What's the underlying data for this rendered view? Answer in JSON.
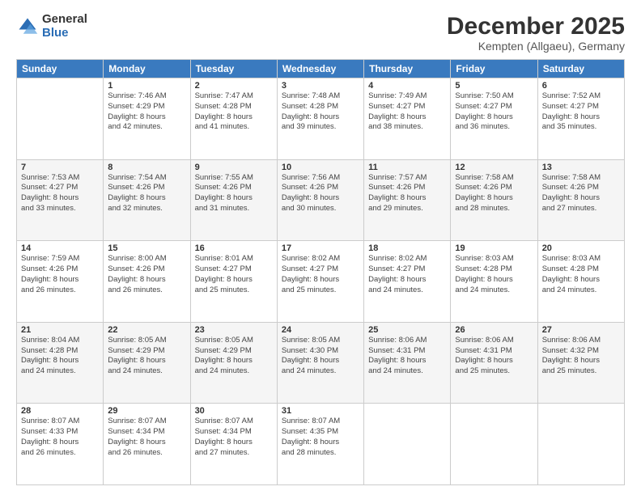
{
  "logo": {
    "general": "General",
    "blue": "Blue"
  },
  "header": {
    "month": "December 2025",
    "location": "Kempten (Allgaeu), Germany"
  },
  "weekdays": [
    "Sunday",
    "Monday",
    "Tuesday",
    "Wednesday",
    "Thursday",
    "Friday",
    "Saturday"
  ],
  "weeks": [
    [
      {
        "day": "",
        "info": ""
      },
      {
        "day": "1",
        "info": "Sunrise: 7:46 AM\nSunset: 4:29 PM\nDaylight: 8 hours\nand 42 minutes."
      },
      {
        "day": "2",
        "info": "Sunrise: 7:47 AM\nSunset: 4:28 PM\nDaylight: 8 hours\nand 41 minutes."
      },
      {
        "day": "3",
        "info": "Sunrise: 7:48 AM\nSunset: 4:28 PM\nDaylight: 8 hours\nand 39 minutes."
      },
      {
        "day": "4",
        "info": "Sunrise: 7:49 AM\nSunset: 4:27 PM\nDaylight: 8 hours\nand 38 minutes."
      },
      {
        "day": "5",
        "info": "Sunrise: 7:50 AM\nSunset: 4:27 PM\nDaylight: 8 hours\nand 36 minutes."
      },
      {
        "day": "6",
        "info": "Sunrise: 7:52 AM\nSunset: 4:27 PM\nDaylight: 8 hours\nand 35 minutes."
      }
    ],
    [
      {
        "day": "7",
        "info": "Sunrise: 7:53 AM\nSunset: 4:27 PM\nDaylight: 8 hours\nand 33 minutes."
      },
      {
        "day": "8",
        "info": "Sunrise: 7:54 AM\nSunset: 4:26 PM\nDaylight: 8 hours\nand 32 minutes."
      },
      {
        "day": "9",
        "info": "Sunrise: 7:55 AM\nSunset: 4:26 PM\nDaylight: 8 hours\nand 31 minutes."
      },
      {
        "day": "10",
        "info": "Sunrise: 7:56 AM\nSunset: 4:26 PM\nDaylight: 8 hours\nand 30 minutes."
      },
      {
        "day": "11",
        "info": "Sunrise: 7:57 AM\nSunset: 4:26 PM\nDaylight: 8 hours\nand 29 minutes."
      },
      {
        "day": "12",
        "info": "Sunrise: 7:58 AM\nSunset: 4:26 PM\nDaylight: 8 hours\nand 28 minutes."
      },
      {
        "day": "13",
        "info": "Sunrise: 7:58 AM\nSunset: 4:26 PM\nDaylight: 8 hours\nand 27 minutes."
      }
    ],
    [
      {
        "day": "14",
        "info": "Sunrise: 7:59 AM\nSunset: 4:26 PM\nDaylight: 8 hours\nand 26 minutes."
      },
      {
        "day": "15",
        "info": "Sunrise: 8:00 AM\nSunset: 4:26 PM\nDaylight: 8 hours\nand 26 minutes."
      },
      {
        "day": "16",
        "info": "Sunrise: 8:01 AM\nSunset: 4:27 PM\nDaylight: 8 hours\nand 25 minutes."
      },
      {
        "day": "17",
        "info": "Sunrise: 8:02 AM\nSunset: 4:27 PM\nDaylight: 8 hours\nand 25 minutes."
      },
      {
        "day": "18",
        "info": "Sunrise: 8:02 AM\nSunset: 4:27 PM\nDaylight: 8 hours\nand 24 minutes."
      },
      {
        "day": "19",
        "info": "Sunrise: 8:03 AM\nSunset: 4:28 PM\nDaylight: 8 hours\nand 24 minutes."
      },
      {
        "day": "20",
        "info": "Sunrise: 8:03 AM\nSunset: 4:28 PM\nDaylight: 8 hours\nand 24 minutes."
      }
    ],
    [
      {
        "day": "21",
        "info": "Sunrise: 8:04 AM\nSunset: 4:28 PM\nDaylight: 8 hours\nand 24 minutes."
      },
      {
        "day": "22",
        "info": "Sunrise: 8:05 AM\nSunset: 4:29 PM\nDaylight: 8 hours\nand 24 minutes."
      },
      {
        "day": "23",
        "info": "Sunrise: 8:05 AM\nSunset: 4:29 PM\nDaylight: 8 hours\nand 24 minutes."
      },
      {
        "day": "24",
        "info": "Sunrise: 8:05 AM\nSunset: 4:30 PM\nDaylight: 8 hours\nand 24 minutes."
      },
      {
        "day": "25",
        "info": "Sunrise: 8:06 AM\nSunset: 4:31 PM\nDaylight: 8 hours\nand 24 minutes."
      },
      {
        "day": "26",
        "info": "Sunrise: 8:06 AM\nSunset: 4:31 PM\nDaylight: 8 hours\nand 25 minutes."
      },
      {
        "day": "27",
        "info": "Sunrise: 8:06 AM\nSunset: 4:32 PM\nDaylight: 8 hours\nand 25 minutes."
      }
    ],
    [
      {
        "day": "28",
        "info": "Sunrise: 8:07 AM\nSunset: 4:33 PM\nDaylight: 8 hours\nand 26 minutes."
      },
      {
        "day": "29",
        "info": "Sunrise: 8:07 AM\nSunset: 4:34 PM\nDaylight: 8 hours\nand 26 minutes."
      },
      {
        "day": "30",
        "info": "Sunrise: 8:07 AM\nSunset: 4:34 PM\nDaylight: 8 hours\nand 27 minutes."
      },
      {
        "day": "31",
        "info": "Sunrise: 8:07 AM\nSunset: 4:35 PM\nDaylight: 8 hours\nand 28 minutes."
      },
      {
        "day": "",
        "info": ""
      },
      {
        "day": "",
        "info": ""
      },
      {
        "day": "",
        "info": ""
      }
    ]
  ]
}
